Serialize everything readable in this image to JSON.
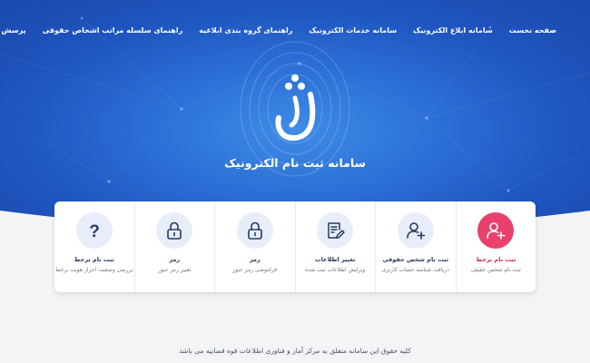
{
  "nav": {
    "items": [
      "صفحه نخست",
      "سامانه ابلاغ الکترونیک",
      "سامانه خدمات الکترونیک",
      "راهنمای گروه بندی ابلاغیه",
      "راهنمای سلسله مراتب اشخاص حقوقی",
      "پرسش های متداول"
    ]
  },
  "hero": {
    "logo_text": "ثنا",
    "title": "سامانه ثبت نام الکترونیک"
  },
  "cards": [
    {
      "icon": "user-plus-icon",
      "title": "ثبت نام برخط",
      "subtitle": "ثبت نام شخص حقیقی"
    },
    {
      "icon": "user-plus-icon",
      "title": "ثبت نام شخص حقوقی",
      "subtitle": "دریافت شناسه حساب کاربری"
    },
    {
      "icon": "document-edit-icon",
      "title": "تغییر اطلاعات",
      "subtitle": "ویرایش اطلاعات ثبت شده"
    },
    {
      "icon": "lock-icon",
      "title": "رمز",
      "subtitle": "فراموشی رمز عبور"
    },
    {
      "icon": "lock-icon",
      "title": "رمز",
      "subtitle": "تغییر رمز عبور"
    },
    {
      "icon": "question-icon",
      "title": "ثبت نام برخط",
      "subtitle": "بررسی وضعیت احراز هویت برخط"
    }
  ],
  "footer": {
    "text": "کلیه حقوق این سامانه متعلق به مرکز آمار و فناوری اطلاعات قوه قضاییه می باشد"
  },
  "colors": {
    "hero_blue": "#2b6fd6",
    "accent_pink": "#e9416c",
    "icon_navy": "#253a63"
  }
}
